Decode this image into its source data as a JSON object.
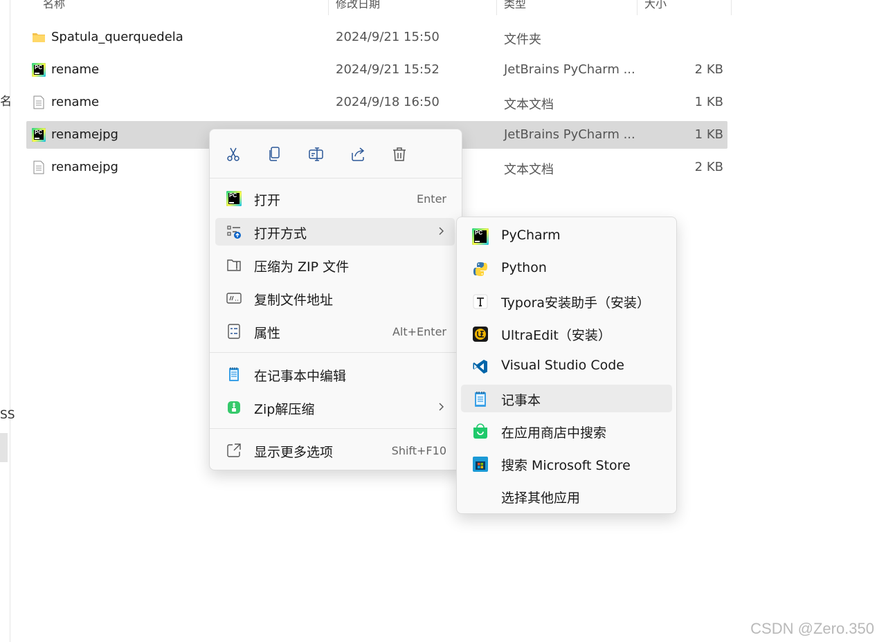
{
  "nav_fragments": [
    "名",
    "SS"
  ],
  "columns": {
    "name": "名称",
    "date": "修改日期",
    "type": "类型",
    "size": "大小"
  },
  "files": [
    {
      "name": "Spatula_querquedela",
      "date": "2024/9/21 15:50",
      "type": "文件夹",
      "size": "",
      "icon": "folder-icon"
    },
    {
      "name": "rename",
      "date": "2024/9/21 15:52",
      "type": "JetBrains PyCharm ...",
      "size": "2 KB",
      "icon": "pycharm-file-icon"
    },
    {
      "name": "rename",
      "date": "2024/9/18 16:50",
      "type": "文本文档",
      "size": "1 KB",
      "icon": "text-file-icon"
    },
    {
      "name": "renamejpg",
      "date": "",
      "type": "JetBrains PyCharm ...",
      "size": "1 KB",
      "icon": "pycharm-file-icon"
    },
    {
      "name": "renamejpg",
      "date": "",
      "type": "文本文档",
      "size": "2 KB",
      "icon": "text-file-icon"
    }
  ],
  "context_menu": {
    "quick_actions": [
      "cut-icon",
      "copy-icon",
      "rename-icon",
      "share-icon",
      "delete-icon"
    ],
    "items": [
      {
        "label": "打开",
        "shortcut": "Enter",
        "icon": "pycharm-icon"
      },
      {
        "label": "打开方式",
        "shortcut": "",
        "icon": "open-with-icon",
        "submenu": true
      },
      {
        "label": "压缩为 ZIP 文件",
        "shortcut": "",
        "icon": "zip-folder-icon"
      },
      {
        "label": "复制文件地址",
        "shortcut": "",
        "icon": "copy-path-icon"
      },
      {
        "label": "属性",
        "shortcut": "Alt+Enter",
        "icon": "properties-icon"
      },
      {
        "label": "在记事本中编辑",
        "shortcut": "",
        "icon": "notepad-icon"
      },
      {
        "label": "Zip解压缩",
        "shortcut": "",
        "icon": "zip-extract-icon",
        "submenu": true
      },
      {
        "label": "显示更多选项",
        "shortcut": "Shift+F10",
        "icon": "more-options-icon"
      }
    ]
  },
  "open_with_menu": {
    "items": [
      {
        "label": "PyCharm",
        "icon": "pycharm-icon"
      },
      {
        "label": "Python",
        "icon": "python-icon"
      },
      {
        "label": "Typora安装助手（安装）",
        "icon": "typora-icon"
      },
      {
        "label": "UltraEdit（安装）",
        "icon": "ultraedit-icon"
      },
      {
        "label": "Visual Studio Code",
        "icon": "vscode-icon"
      },
      {
        "label": "记事本",
        "icon": "notepad-icon"
      },
      {
        "label": "在应用商店中搜索",
        "icon": "store-search-icon"
      },
      {
        "label": "搜索 Microsoft Store",
        "icon": "microsoft-store-icon"
      },
      {
        "label": "选择其他应用",
        "icon": ""
      }
    ]
  },
  "watermark": "CSDN @Zero.350",
  "colors": {
    "selection": "#d9d9d9",
    "menu_bg": "#f9f9f9",
    "hover": "#ebebeb",
    "icon_blue": "#2b5797"
  }
}
